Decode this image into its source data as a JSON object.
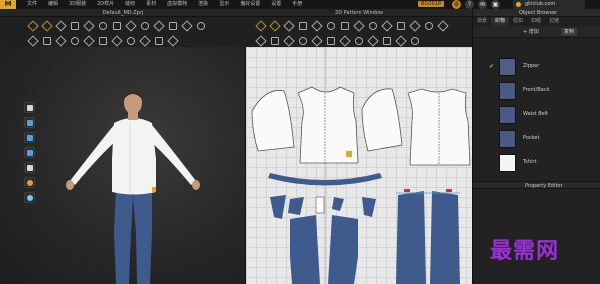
{
  "app": {
    "logo": "M"
  },
  "menu": [
    "文件",
    "编辑",
    "3D服装",
    "2D样片",
    "缝纫",
    "素材",
    "虚拟模特",
    "渲染",
    "显示",
    "偏好设置",
    "设置",
    "手册"
  ],
  "badge": "BO2018",
  "user": {
    "name": "gkiclub.com"
  },
  "titles": {
    "viewport3d": "Default_MD.Zprj",
    "pattern": "2D Pattern Window",
    "object_browser": "Object Browser"
  },
  "right_panel": {
    "tabs": [
      "场景",
      "织物",
      "纽扣",
      "扣眼",
      "拉链"
    ],
    "active_tab": 1,
    "add_label": "+ 增加",
    "button_label": "复制",
    "fabrics": [
      {
        "name": "Zipper",
        "selected": true,
        "color": "#4e5f86"
      },
      {
        "name": "Front/Back",
        "selected": false,
        "color": "#4a5a84"
      },
      {
        "name": "Waist Belt",
        "selected": false,
        "color": "#4a5a84"
      },
      {
        "name": "Pocket",
        "selected": false,
        "color": "#4a5a84"
      },
      {
        "name": "Tshirt",
        "selected": false,
        "color": "#f4f4f4"
      }
    ],
    "property_editor": "Property Editor"
  },
  "watermark": "最需网",
  "colors": {
    "accent": "#e3a52e",
    "denim": "#4a5a84",
    "shirt": "#f4f4f4",
    "watermark": "#9b2fd8"
  }
}
